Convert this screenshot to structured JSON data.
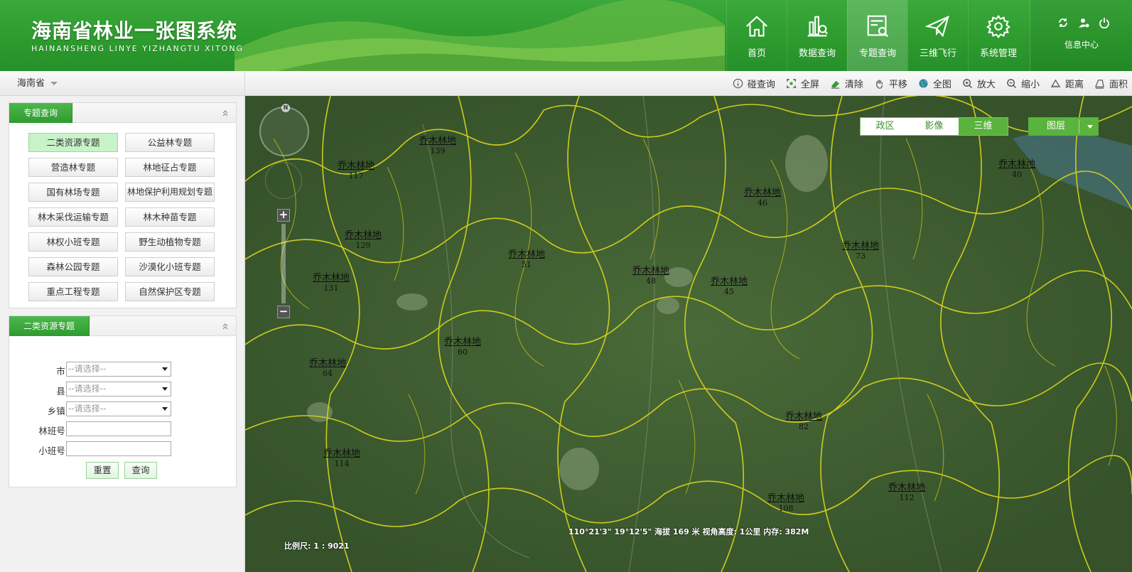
{
  "header": {
    "title": "海南省林业一张图系统",
    "subtitle": "HAINANSHENG LINYE YIZHANGTU XITONG",
    "nav": [
      {
        "label": "首页",
        "icon": "home-icon"
      },
      {
        "label": "数据查询",
        "icon": "data-query-icon"
      },
      {
        "label": "专题查询",
        "icon": "topic-query-icon",
        "active": true
      },
      {
        "label": "三维飞行",
        "icon": "paper-plane-icon"
      },
      {
        "label": "系统管理",
        "icon": "gear-icon"
      }
    ],
    "info_center": "信息中心",
    "colors": {
      "brand": "#2c9a2c",
      "accent": "#59b33c"
    }
  },
  "region": {
    "selected": "海南省"
  },
  "toolbar": {
    "tools": [
      {
        "label": "碰查询",
        "icon": "info-icon"
      },
      {
        "label": "全屏",
        "icon": "fullscreen-icon"
      },
      {
        "label": "清除",
        "icon": "eraser-icon"
      },
      {
        "label": "平移",
        "icon": "hand-icon"
      },
      {
        "label": "全图",
        "icon": "globe-icon"
      },
      {
        "label": "放大",
        "icon": "zoom-in-icon"
      },
      {
        "label": "缩小",
        "icon": "zoom-out-icon"
      },
      {
        "label": "距离",
        "icon": "ruler-icon"
      },
      {
        "label": "面积",
        "icon": "area-icon"
      }
    ]
  },
  "topics_panel": {
    "title": "专题查询",
    "items": [
      "二类资源专题",
      "公益林专题",
      "营造林专题",
      "林地征占专题",
      "国有林场专题",
      "林地保护利用规划专题",
      "林木采伐运输专题",
      "林木种苗专题",
      "林权小班专题",
      "野生动植物专题",
      "森林公园专题",
      "沙漠化小班专题",
      "重点工程专题",
      "自然保护区专题"
    ],
    "active_index": 0
  },
  "form_panel": {
    "title": "二类资源专题",
    "fields": [
      {
        "label": "市:",
        "type": "select",
        "value": "--请选择--"
      },
      {
        "label": "县:",
        "type": "select",
        "value": "--请选择--"
      },
      {
        "label": "乡镇:",
        "type": "select",
        "value": "--请选择--"
      },
      {
        "label": "林班号:",
        "type": "text",
        "value": ""
      },
      {
        "label": "小班号:",
        "type": "text",
        "value": ""
      }
    ],
    "reset_label": "重置",
    "query_label": "查询"
  },
  "map": {
    "basemaps": [
      "政区",
      "影像",
      "三维"
    ],
    "active_basemap": "三维",
    "layer_label": "图层",
    "compass_label": "N",
    "status": "110°21'3\" 19°12'5\" 海拔 169 米  视角高度: 1公里  内存: 382M",
    "scale": "比例尺: 1 : 9021",
    "parcel_labels": [
      {
        "name": "乔木林地",
        "id": "139"
      },
      {
        "name": "乔木林地",
        "id": "117"
      },
      {
        "name": "乔木林地",
        "id": "129"
      },
      {
        "name": "乔木林地",
        "id": "131"
      },
      {
        "name": "乔木林地",
        "id": "46"
      },
      {
        "name": "乔木林地",
        "id": "51"
      },
      {
        "name": "乔木林地",
        "id": "48"
      },
      {
        "name": "乔木林地",
        "id": "45"
      },
      {
        "name": "乔木林地",
        "id": "60"
      },
      {
        "name": "乔木林地",
        "id": "64"
      },
      {
        "name": "乔木林地",
        "id": "73"
      },
      {
        "name": "乔木林地",
        "id": "114"
      },
      {
        "name": "乔木林地",
        "id": "108"
      },
      {
        "name": "乔木林地",
        "id": "112"
      },
      {
        "name": "乔木林地",
        "id": "82"
      },
      {
        "name": "乔木林地",
        "id": "40"
      }
    ]
  }
}
